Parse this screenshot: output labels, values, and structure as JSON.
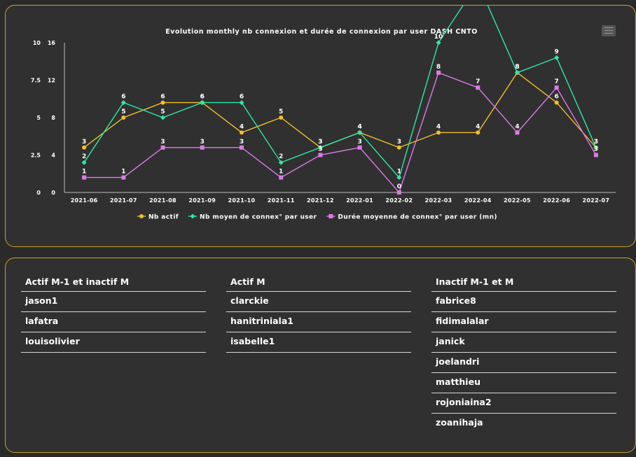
{
  "chart_data": {
    "type": "line",
    "title": "Evolution monthly nb connexion et durée de connexion par user DASH CNTO",
    "categories": [
      "2021-06",
      "2021-07",
      "2021-08",
      "2021-09",
      "2021-10",
      "2021-11",
      "2021-12",
      "2022-01",
      "2022-02",
      "2022-03",
      "2022-04",
      "2022-05",
      "2022-06",
      "2022-07"
    ],
    "left_axis": {
      "ticks": [
        "0",
        "2.5",
        "5",
        "7.5",
        "10"
      ],
      "range": [
        0,
        10
      ]
    },
    "right_axis": {
      "ticks": [
        "0",
        "4",
        "8",
        "12",
        "16"
      ],
      "range": [
        0,
        16
      ]
    },
    "series": [
      {
        "name": "Nb actif",
        "color": "#f0c02a",
        "marker": "circle",
        "values": [
          3,
          5,
          6,
          6,
          4,
          5,
          3,
          4,
          3,
          4,
          4,
          8,
          6,
          3
        ],
        "labels": [
          "3",
          "5",
          "6",
          "6",
          "4",
          "5",
          "3",
          "4",
          "3",
          "4",
          "4",
          "8",
          "6",
          "3"
        ]
      },
      {
        "name": "Nb moyen de connex° par user",
        "color": "#2ee8a6",
        "marker": "diamond",
        "values": [
          2,
          6,
          5,
          6,
          6,
          2,
          3,
          4,
          1,
          10,
          14,
          8,
          9,
          3
        ],
        "labels": [
          "2",
          "6",
          "5",
          "6",
          "6",
          "2",
          "3",
          "4",
          "1",
          "10",
          "14",
          "8",
          "9",
          "3"
        ]
      },
      {
        "name": "Durée moyenne de connex° par user (mn)",
        "color": "#dd7ae8",
        "marker": "square",
        "values": [
          1,
          1,
          3,
          3,
          3,
          1,
          2.5,
          3,
          0,
          8,
          7,
          4,
          7,
          2.5
        ],
        "labels": [
          "1",
          "1",
          "3",
          "3",
          "3",
          "1",
          "3",
          "3",
          "0",
          "8",
          "7",
          "4",
          "7",
          "3"
        ]
      }
    ],
    "legend_position": "bottom",
    "grid": false
  },
  "lists": [
    {
      "title": "Actif M-1 et inactif M",
      "items": [
        "jason1",
        "lafatra",
        "louisolivier"
      ]
    },
    {
      "title": "Actif M",
      "items": [
        "clarckie",
        "hanitriniala1",
        "isabelle1"
      ]
    },
    {
      "title": "Inactif M-1 et M",
      "items": [
        "fabrice8",
        "fidimalalar",
        "janick",
        "joelandri",
        "matthieu",
        "rojoniaina2",
        "zoanihaja"
      ]
    }
  ]
}
